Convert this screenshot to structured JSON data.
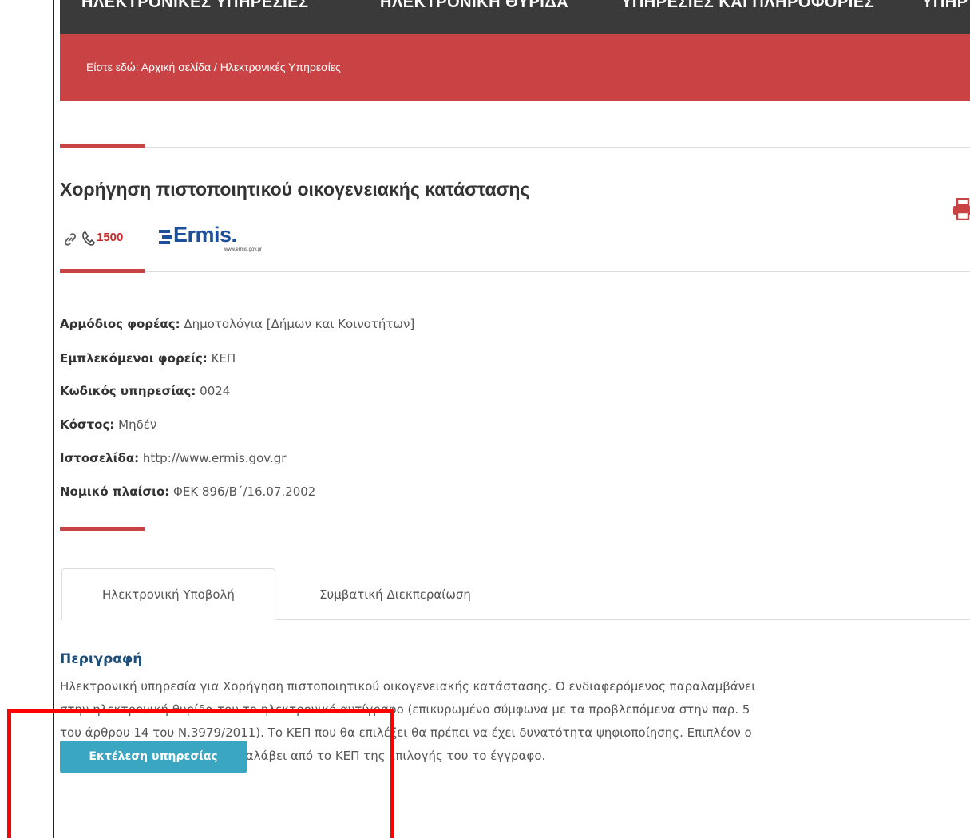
{
  "topnav": {
    "items": [
      "ΗΛΕΚΤΡΟΝΙΚΕΣ ΥΠΗΡΕΣΙΕΣ",
      "ΗΛΕΚΤΡΟΝΙΚΗ ΘΥΡΙΔΑ",
      "ΥΠΗΡΕΣΙΕΣ ΚΑΙ ΠΛΗΡΟΦΟΡΙΕΣ",
      "ΥΠΗΡ"
    ]
  },
  "breadcrumb": {
    "text": "Είστε εδώ: Αρχική σελίδα / Ηλεκτρονικές Υπηρεσίες"
  },
  "service": {
    "title": "Χορήγηση πιστοποιητικού οικογενειακής κατάστασης",
    "phone": "1500",
    "logo_text": "Ermis.",
    "logo_sub": "www.ermis.gov.gr"
  },
  "info": [
    {
      "label": "Αρμόδιος φορέας:",
      "value": "Δημοτολόγια [Δήμων και Κοινοτήτων]"
    },
    {
      "label": "Εμπλεκόμενοι φορείς:",
      "value": "ΚΕΠ"
    },
    {
      "label": "Κωδικός υπηρεσίας:",
      "value": "0024"
    },
    {
      "label": "Κόστος:",
      "value": "Μηδέν"
    },
    {
      "label": "Ιστοσελίδα:",
      "value": "http://www.ermis.gov.gr"
    },
    {
      "label": "Νομικό πλαίσιο:",
      "value": "ΦΕΚ 896/Β΄/16.07.2002"
    }
  ],
  "tabs": [
    {
      "label": "Ηλεκτρονική Υποβολή"
    },
    {
      "label": "Συμβατική Διεκπεραίωση"
    }
  ],
  "description": {
    "title": "Περιγραφή",
    "lines": [
      "Ηλεκτρονική υπηρεσία για Χορήγηση πιστοποιητικού οικογενειακής κατάστασης. Ο ενδιαφερόμενος παραλαμβάνει",
      "στην ηλεκτρονική θυρίδα του το ηλεκτρονικό αντίγραφο (επικυρωμένο σύμφωνα με τα προβλεπόμενα στην παρ. 5",
      "του άρθρου 14 του Ν.3979/2011). Το ΚΕΠ που θα επιλέξει θα πρέπει να έχει δυνατότητα ψηφιοποίησης. Επιπλέον ο",
      "ενδιαφερόμενος μπορεί να παραλάβει από το ΚΕΠ της επιλογής του το έγγραφο."
    ]
  },
  "action": {
    "execute_label": "Εκτέλεση υπηρεσίας"
  },
  "colors": {
    "accent_red": "#c94345",
    "button_teal": "#3ba6c1",
    "nav_dark": "#3a3a3a",
    "highlight": "#ff0000"
  },
  "icons": [
    "link-icon",
    "phone-icon",
    "print-icon"
  ]
}
